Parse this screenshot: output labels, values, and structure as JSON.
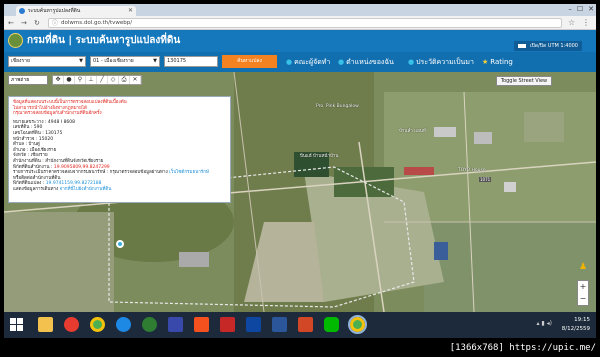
{
  "browser": {
    "tab_title": "ระบบค้นหารูปแปลงที่ดิน",
    "url": "dolwms.dol.go.th/tvwebp/"
  },
  "header": {
    "title": "กรมที่ดิน | ระบบค้นหารูปแปลงที่ดิน",
    "utm_label": "เปิด/ปิด UTM 1:4000"
  },
  "search": {
    "province": "เชียงราย",
    "district": "01 - เมืองเชียงราย",
    "parcel_no": "130175",
    "find_label": "ค้นหาแปลง",
    "links": [
      "คณะผู้จัดทำ",
      "ตำแหน่งของฉัน",
      "ประวัติความเป็นมา",
      "Rating"
    ]
  },
  "map": {
    "layer_select": "ภาพถ่าย",
    "street_view_label": "Toggle Street View",
    "labels": {
      "place1": "Pro. Pink Bungalow",
      "place2": "ปีนแฮ้ บ้านหน้าบ้าน",
      "place3": "TOYO House",
      "place4": "บ้านลำ แอนท์",
      "road": "1071"
    }
  },
  "popup": {
    "warn1": "ข้อมูลที่แสดงบนระบบนี้เป็นการตรวจสอบแปลงที่ดินเบื้องต้น",
    "warn2": "ไม่สามารถนำไปอ้างอิงทางกฎหมายได้",
    "warn3": "กรุณาตรวจสอบข้อมูลกับสำนักงานที่ดินอีกครั้ง",
    "rows": [
      "หมายเลขระวาง : 4948 I 8608",
      "เลขที่ดิน : 590",
      "เลขโฉนดที่ดิน : 130175",
      "หน้าสำรวจ : 15020",
      "ตำบล : บ้านดู่",
      "อำเภอ : เมืองเชียงราย",
      "จังหวัด : เชียงราย",
      "สำนักงานที่ดิน : สำนักงานที่ดินจังหวัดเชียงราย"
    ],
    "coord1_label": "พิกัดที่ดินสำนักงาน :",
    "coord1_value": "19.9095809,99.8247299",
    "note1": "รายการประเมินราคาตรวจสอบจากกรมธนารักษ์ : กรุณาตรวจสอบข้อมูลผ่านทาง",
    "note1_link": "เว็บไซต์กรมธนารักษ์",
    "note2": "หรือติดต่อสำนักงานที่ดิน",
    "coord2_label": "พิกัดที่ดินแปลง :",
    "coord2_value": "19.9741159,99.8272188",
    "nav_label": "แสดงข้อมูลการเดินทาง",
    "nav_link": "จากที่นี่ไปยังสำนักงานที่ดิน"
  },
  "taskbar": {
    "time": "19:15",
    "date": "8/12/2559"
  },
  "caption": "[1366x768] https://upic.me/"
}
